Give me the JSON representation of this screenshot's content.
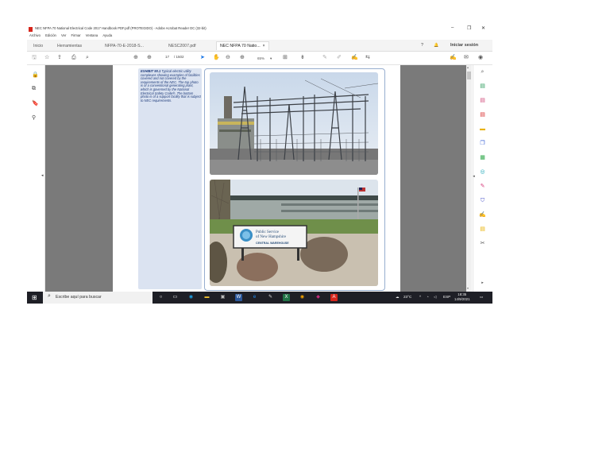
{
  "window": {
    "title": "NEC NFPA 70 National Electrical Code 2017 Handbook PDF.pdf (PROTEGIDO) - Adobe Acrobat Reader DC (32-bit)",
    "controls": {
      "minimize": "–",
      "maximize": "❐",
      "close": "✕"
    }
  },
  "menu": [
    "Archivo",
    "Edición",
    "Ver",
    "Firmar",
    "Ventana",
    "Ayuda"
  ],
  "tabs": {
    "home": "Inicio",
    "tools": "Herramientas",
    "doc1": "NFPA-70-E-2018-S...",
    "doc2": "NESC2007.pdf",
    "doc3": "NEC NFPA 70 Natio...",
    "doc3_close": "×",
    "help_icon": "?",
    "bell_icon": "🔔",
    "signin": "Iniciar sesión"
  },
  "toolbar": {
    "page_current": "17",
    "page_total": "/ 1502",
    "zoom": "65%",
    "zoom_arrow": "▾"
  },
  "document": {
    "exhibit_label": "EXHIBIT 90.1",
    "caption": "Typical electric utility complexes showing examples of facilities covered and not covered by the requirements of the NEC. The top photo is of a conventional generating plant, which is governed by the National Electrical Safety Code®. The bottom photo is of a support facility that is subject to NEC requirements.",
    "sign_line1": "Public Service",
    "sign_line2": "of New Hampshire",
    "sign_line3": "CENTRAL WAREHOUSE"
  },
  "taskbar": {
    "search_placeholder": "Escribe aquí para buscar",
    "temperature": "23°C",
    "language": "ESP",
    "time": "18:35",
    "date": "14/9/2021"
  },
  "colors": {
    "accent": "#1473e6",
    "caption_bg": "#dbe3f1",
    "caption_text": "#1d3a7a",
    "doc_bg": "#7a7a7a",
    "taskbar": "#1e1f26"
  }
}
